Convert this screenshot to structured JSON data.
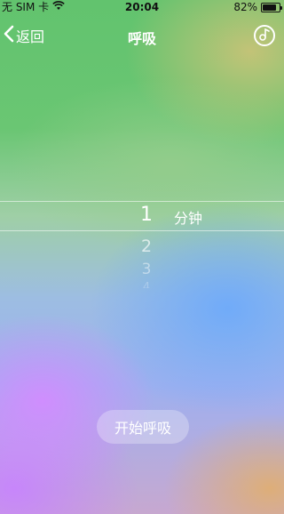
{
  "status_bar": {
    "carrier": "无 SIM 卡",
    "time": "20:04",
    "battery": "82%",
    "battery_level": 0.82
  },
  "nav": {
    "back_label": "返回",
    "title": "呼吸"
  },
  "picker": {
    "selected": "1",
    "unit": "分钟",
    "next_values": [
      "2",
      "3",
      "4"
    ]
  },
  "start_button": {
    "label": "开始呼吸"
  }
}
